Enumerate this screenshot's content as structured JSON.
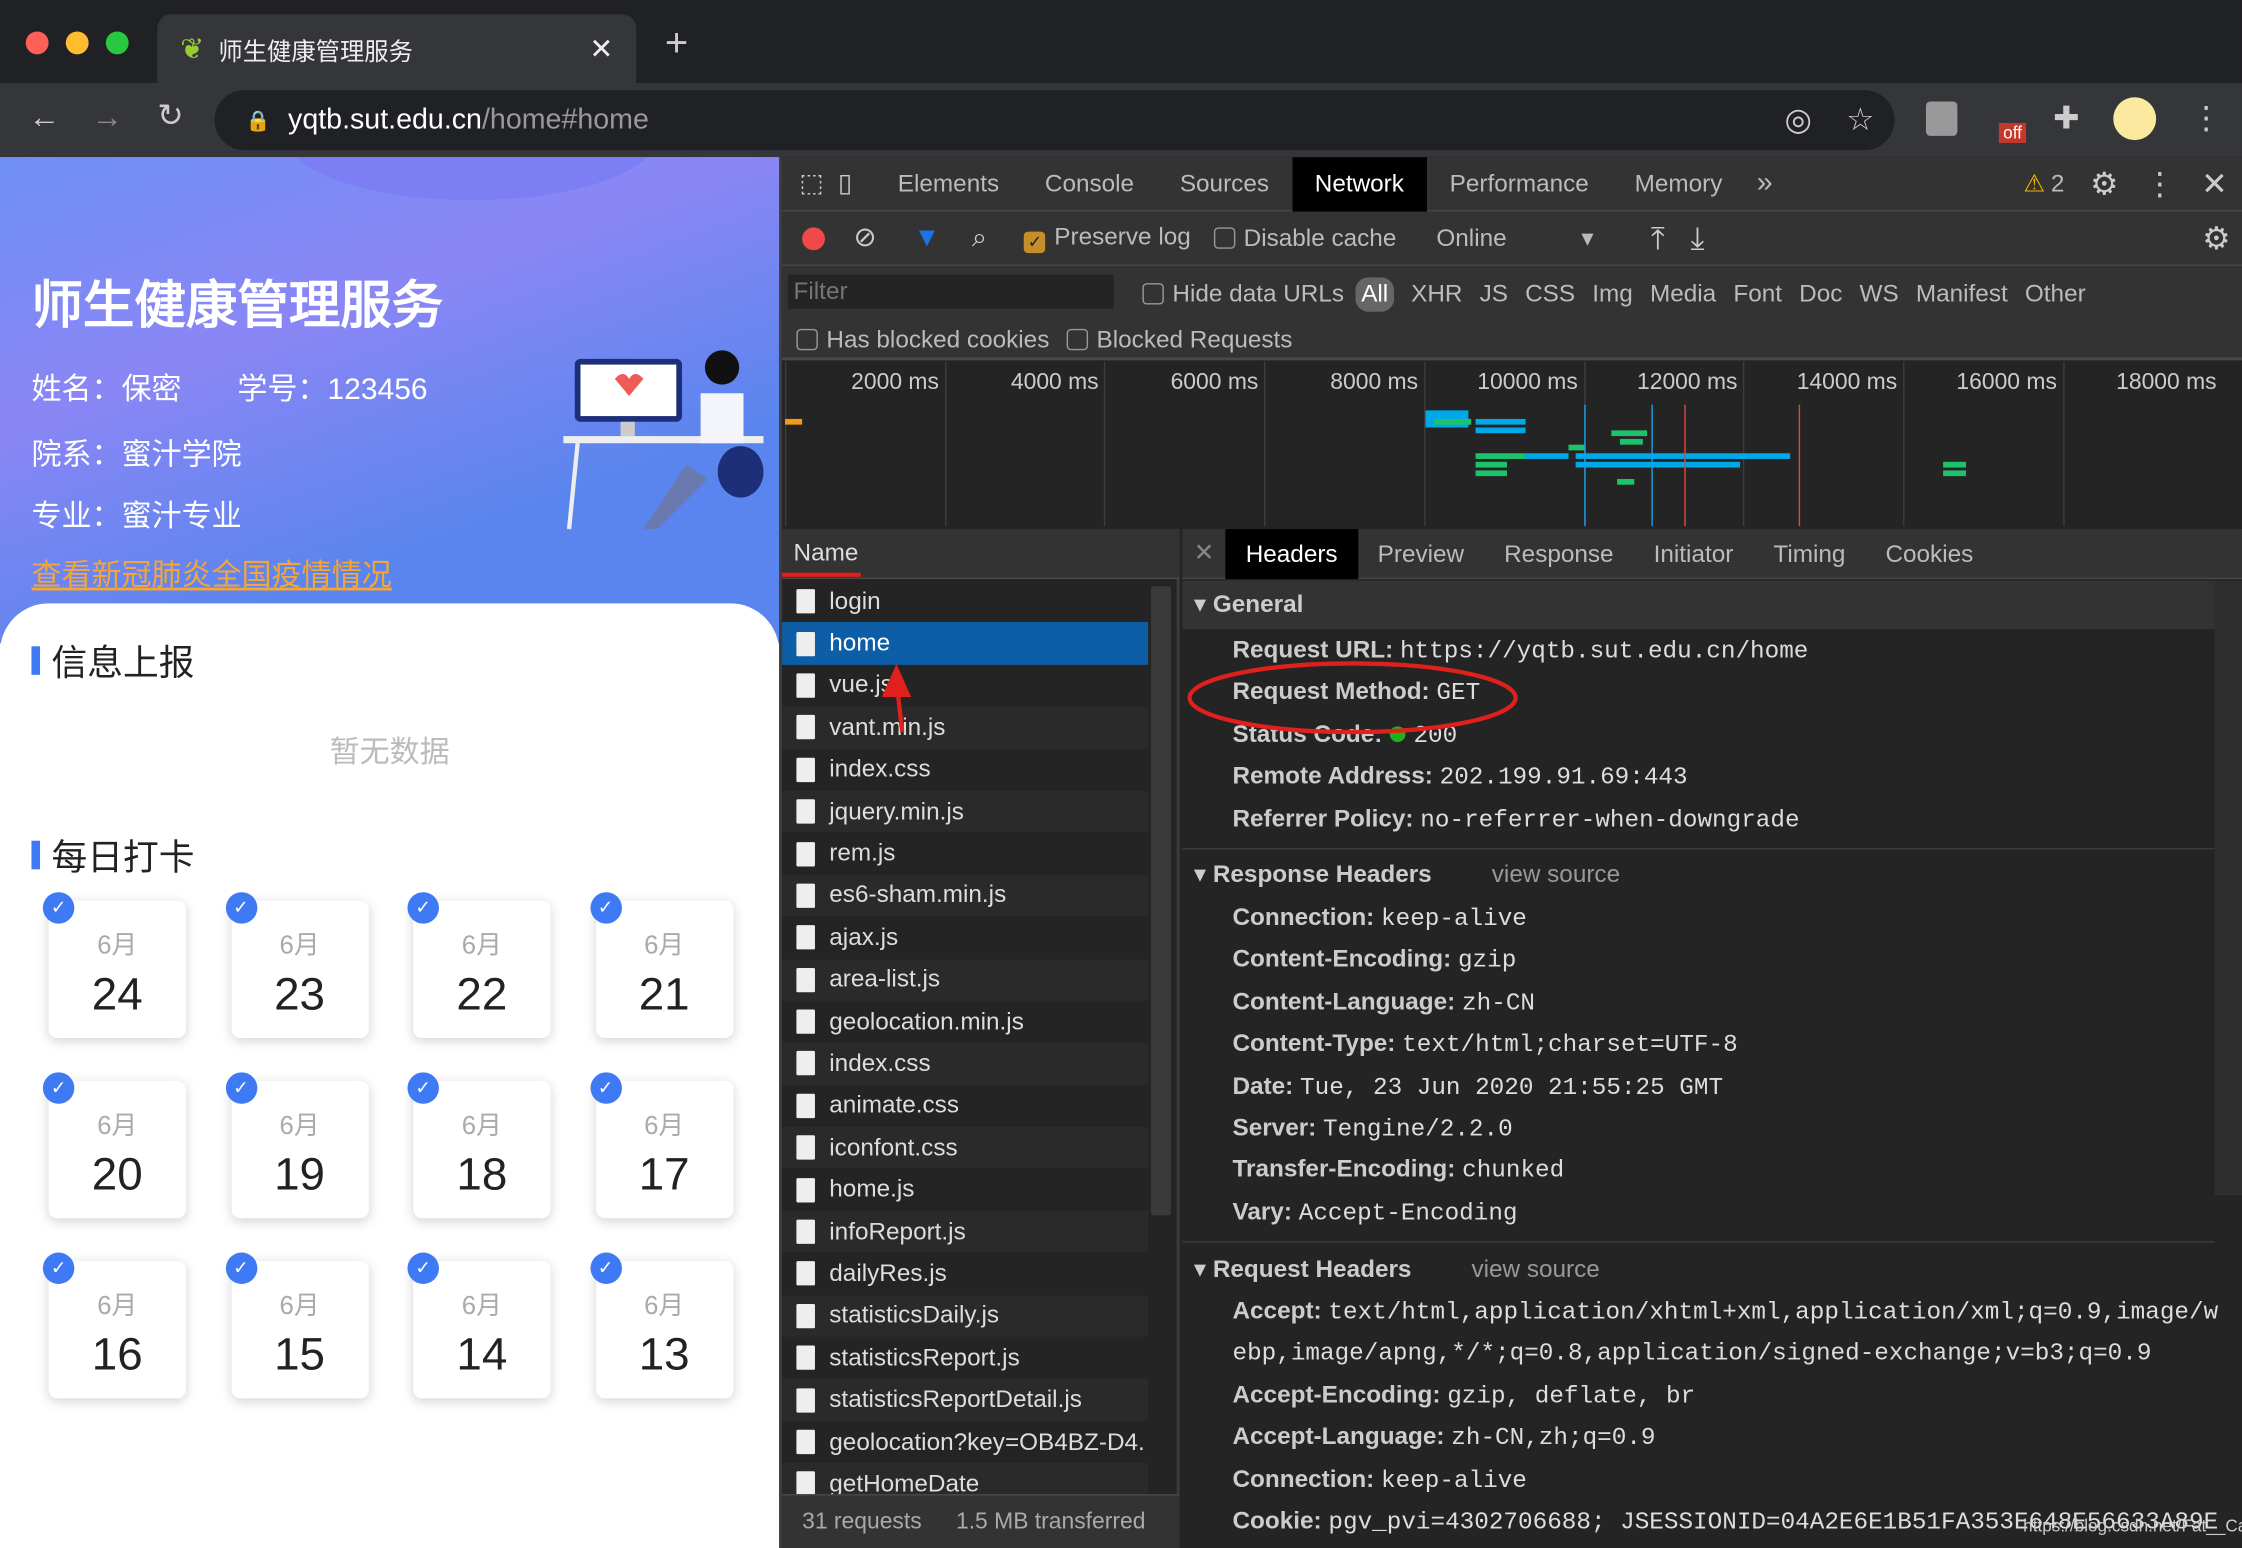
{
  "browser": {
    "tab_title": "师生健康管理服务",
    "url_host": "yqtb.sut.edu.cn",
    "url_path": "/home#home",
    "ext_badge": "off"
  },
  "page": {
    "title": "师生健康管理服务",
    "name": "姓名：保密",
    "student_id": "学号：123456",
    "college": "院系：蜜汁学院",
    "major": "专业：蜜汁专业",
    "epidemic_link": "查看新冠肺炎全国疫情情况",
    "info_report_title": "信息上报",
    "no_data": "暂无数据",
    "daily_checkin_title": "每日打卡",
    "days": [
      {
        "m": "6月",
        "d": "24"
      },
      {
        "m": "6月",
        "d": "23"
      },
      {
        "m": "6月",
        "d": "22"
      },
      {
        "m": "6月",
        "d": "21"
      },
      {
        "m": "6月",
        "d": "20"
      },
      {
        "m": "6月",
        "d": "19"
      },
      {
        "m": "6月",
        "d": "18"
      },
      {
        "m": "6月",
        "d": "17"
      },
      {
        "m": "6月",
        "d": "16"
      },
      {
        "m": "6月",
        "d": "15"
      },
      {
        "m": "6月",
        "d": "14"
      },
      {
        "m": "6月",
        "d": "13"
      }
    ]
  },
  "devtools": {
    "tabs": [
      "Elements",
      "Console",
      "Sources",
      "Network",
      "Performance",
      "Memory"
    ],
    "active_tab": "Network",
    "warnings": "2",
    "toolbar": {
      "preserve_log": "Preserve log",
      "preserve_log_checked": true,
      "disable_cache": "Disable cache",
      "throttle": "Online"
    },
    "filter_placeholder": "Filter",
    "hide_data_urls": "Hide data URLs",
    "types": [
      "All",
      "XHR",
      "JS",
      "CSS",
      "Img",
      "Media",
      "Font",
      "Doc",
      "WS",
      "Manifest",
      "Other"
    ],
    "has_blocked_cookies": "Has blocked cookies",
    "blocked_requests": "Blocked Requests",
    "timeline_ticks": [
      "2000 ms",
      "4000 ms",
      "6000 ms",
      "8000 ms",
      "10000 ms",
      "12000 ms",
      "14000 ms",
      "16000 ms",
      "18000 ms"
    ],
    "name_header": "Name",
    "requests": [
      "login",
      "home",
      "vue.js",
      "vant.min.js",
      "index.css",
      "jquery.min.js",
      "rem.js",
      "es6-sham.min.js",
      "ajax.js",
      "area-list.js",
      "geolocation.min.js",
      "index.css",
      "animate.css",
      "iconfont.css",
      "home.js",
      "infoReport.js",
      "dailyRes.js",
      "statisticsDaily.js",
      "statisticsReport.js",
      "statisticsReportDetail.js",
      "geolocation?key=OB4BZ-D4.",
      "getHomeDate"
    ],
    "selected_request": "home",
    "footer": {
      "requests": "31 requests",
      "transferred": "1.5 MB transferred"
    },
    "detail_tabs": [
      "Headers",
      "Preview",
      "Response",
      "Initiator",
      "Timing",
      "Cookies"
    ],
    "general_title": "General",
    "general": [
      [
        "Request URL:",
        "https://yqtb.sut.edu.cn/home"
      ],
      [
        "Request Method:",
        "GET"
      ],
      [
        "Status Code:",
        "200"
      ],
      [
        "Remote Address:",
        "202.199.91.69:443"
      ],
      [
        "Referrer Policy:",
        "no-referrer-when-downgrade"
      ]
    ],
    "response_headers_title": "Response Headers",
    "view_source": "view source",
    "response_headers": [
      [
        "Connection:",
        "keep-alive"
      ],
      [
        "Content-Encoding:",
        "gzip"
      ],
      [
        "Content-Language:",
        "zh-CN"
      ],
      [
        "Content-Type:",
        "text/html;charset=UTF-8"
      ],
      [
        "Date:",
        "Tue, 23 Jun 2020 21:55:25 GMT"
      ],
      [
        "Server:",
        "Tengine/2.2.0"
      ],
      [
        "Transfer-Encoding:",
        "chunked"
      ],
      [
        "Vary:",
        "Accept-Encoding"
      ]
    ],
    "request_headers_title": "Request Headers",
    "request_headers": [
      [
        "Accept:",
        "text/html,application/xhtml+xml,application/xml;q=0.9,image/w"
      ],
      [
        "",
        "ebp,image/apng,*/*;q=0.8,application/signed-exchange;v=b3;q=0.9"
      ],
      [
        "Accept-Encoding:",
        "gzip, deflate, br"
      ],
      [
        "Accept-Language:",
        "zh-CN,zh;q=0.9"
      ],
      [
        "Connection:",
        "keep-alive"
      ],
      [
        "Cookie:",
        "pgv_pvi=4302706688; JSESSIONID=04A2E6E1B51FA353E648E56633A89E"
      ]
    ],
    "watermark": "https://blog.csdn.net/Fat__Cat",
    "colors": {
      "status_ok": "#1db31d",
      "selected_row": "#0d5ea6",
      "annotation": "#e0201c"
    }
  }
}
